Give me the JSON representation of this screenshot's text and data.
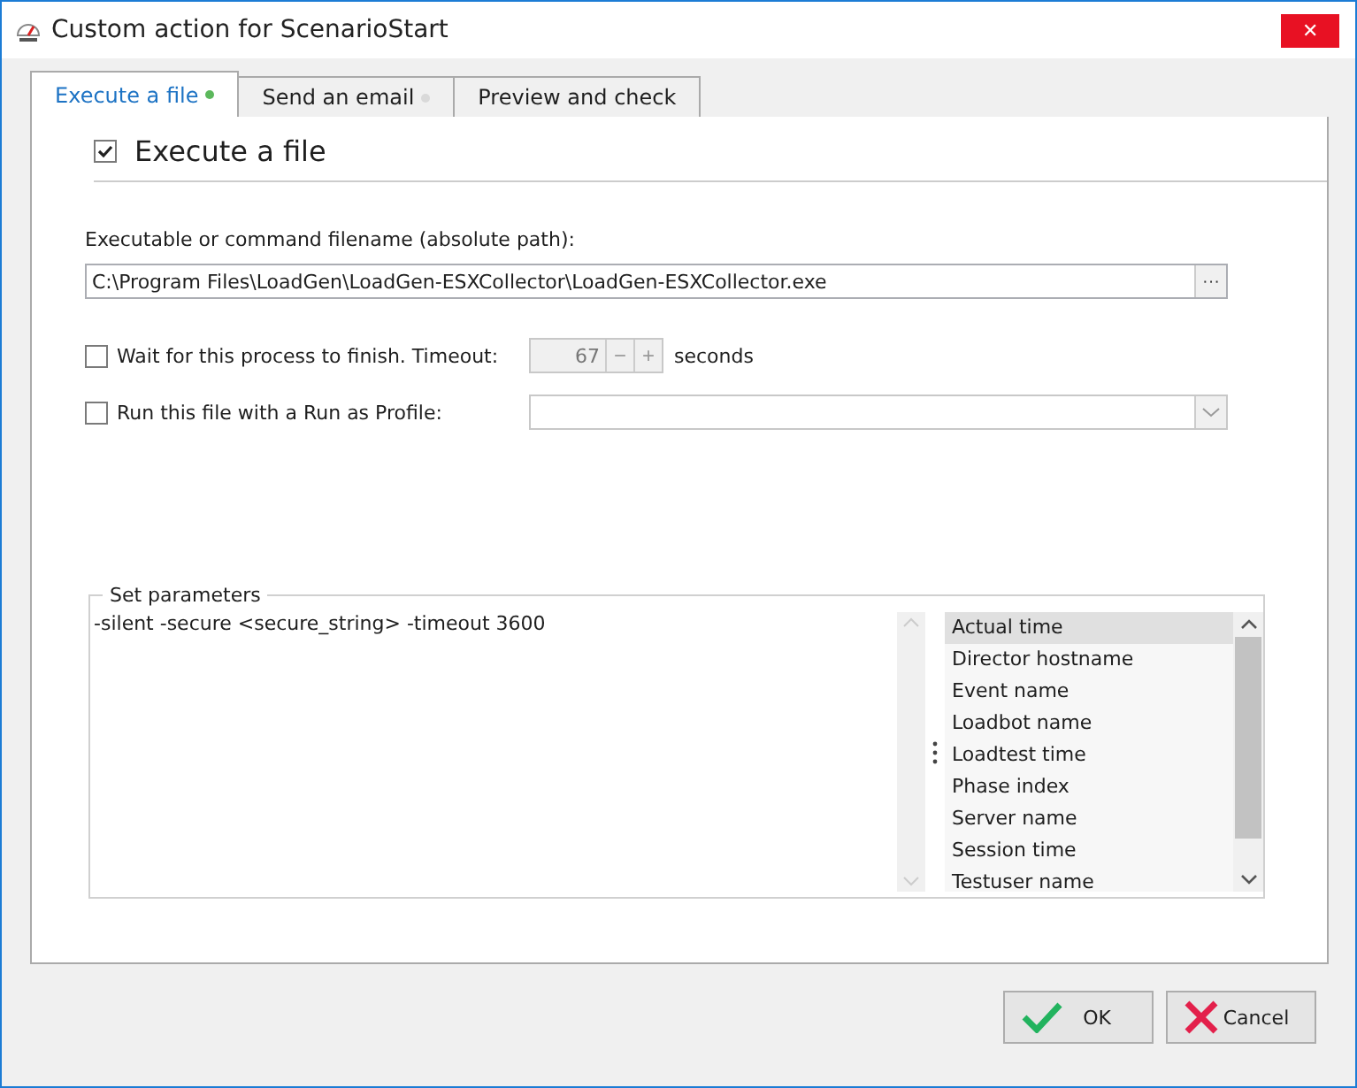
{
  "window": {
    "title": "Custom action for ScenarioStart",
    "close": "✕"
  },
  "tabs": [
    {
      "label": "Execute a file",
      "selected": true,
      "color": "#5cb85c"
    },
    {
      "label": "Send an email",
      "selected": false,
      "color": "#d9d9d9"
    },
    {
      "label": "Preview and check",
      "selected": false
    }
  ],
  "section": {
    "label": "Execute a file",
    "checked": true
  },
  "filename": {
    "label": "Executable or command filename (absolute path):",
    "value": "C:\\Program Files\\LoadGen\\LoadGen-ESXCollector\\LoadGen-ESXCollector.exe",
    "browse": "···"
  },
  "wait": {
    "label": "Wait for this process to finish.  Timeout:",
    "checked": false,
    "timeout": "67",
    "minus": "−",
    "plus": "+",
    "unit": "seconds"
  },
  "run_as": {
    "label": "Run this file with a Run as Profile:",
    "checked": false
  },
  "parameters": {
    "title": "Set parameters",
    "value": "-silent -secure <secure_string> -timeout 3600",
    "variables": [
      {
        "label": "Actual time",
        "selected": true
      },
      {
        "label": "Director hostname",
        "selected": false
      },
      {
        "label": "Event name",
        "selected": false
      },
      {
        "label": "Loadbot name",
        "selected": false
      },
      {
        "label": "Loadtest time",
        "selected": false
      },
      {
        "label": "Phase index",
        "selected": false
      },
      {
        "label": "Server name",
        "selected": false
      },
      {
        "label": "Session time",
        "selected": false
      },
      {
        "label": "Testuser name",
        "selected": false
      }
    ]
  },
  "buttons": [
    {
      "label": "OK",
      "kind": "ok"
    },
    {
      "label": "Cancel",
      "kind": "cancel"
    }
  ]
}
